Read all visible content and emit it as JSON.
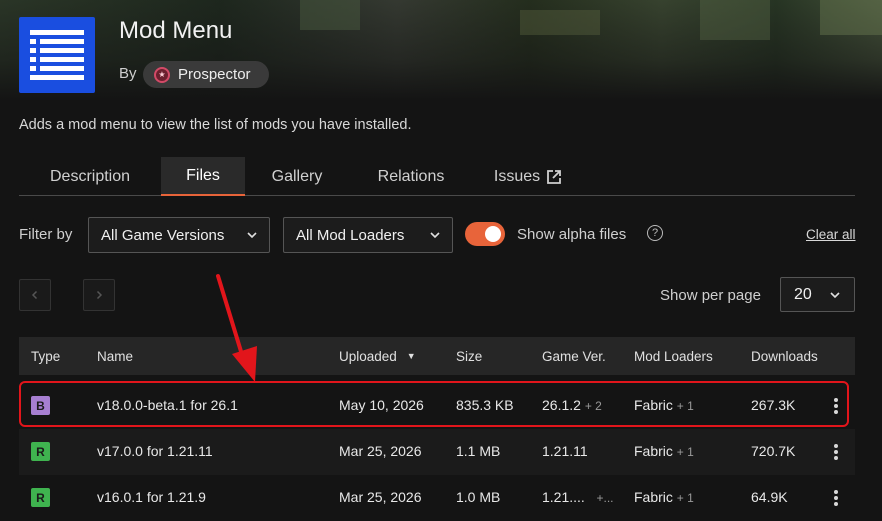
{
  "mod": {
    "title": "Mod Menu",
    "by_label": "By",
    "author": "Prospector",
    "summary": "Adds a mod menu to view the list of mods you have installed."
  },
  "tabs": [
    {
      "label": "Description",
      "active": false
    },
    {
      "label": "Files",
      "active": true
    },
    {
      "label": "Gallery",
      "active": false
    },
    {
      "label": "Relations",
      "active": false
    },
    {
      "label": "Issues",
      "active": false,
      "icon": "external-link-icon"
    }
  ],
  "filters": {
    "label": "Filter by",
    "game_versions": "All Game Versions",
    "mod_loaders": "All Mod Loaders",
    "show_alpha_label": "Show alpha files",
    "show_alpha_on": true,
    "clear_all": "Clear all"
  },
  "pagination": {
    "per_page_label": "Show per page",
    "per_page_value": "20"
  },
  "table": {
    "columns": [
      "Type",
      "Name",
      "Uploaded",
      "Size",
      "Game Ver.",
      "Mod Loaders",
      "Downloads"
    ],
    "sorted_by": "Uploaded",
    "rows": [
      {
        "type": "B",
        "type_color": "#a77fd1",
        "name": "v18.0.0-beta.1 for 26.1",
        "uploaded": "May 10, 2026",
        "size": "835.3 KB",
        "game_ver": "26.1.2",
        "game_ver_extra": "+ 2",
        "loader": "Fabric",
        "loader_extra": "+ 1",
        "downloads": "267.3K",
        "highlighted": true
      },
      {
        "type": "R",
        "type_color": "#3fb34f",
        "name": "v17.0.0 for 1.21.11",
        "uploaded": "Mar 25, 2026",
        "size": "1.1 MB",
        "game_ver": "1.21.11",
        "game_ver_extra": "",
        "loader": "Fabric",
        "loader_extra": "+ 1",
        "downloads": "720.7K",
        "highlighted": false
      },
      {
        "type": "R",
        "type_color": "#3fb34f",
        "name": "v16.0.1 for 1.21.9",
        "uploaded": "Mar 25, 2026",
        "size": "1.0 MB",
        "game_ver": "1.21....",
        "game_ver_extra": "+...",
        "loader": "Fabric",
        "loader_extra": "+ 1",
        "downloads": "64.9K",
        "highlighted": false
      }
    ]
  },
  "colors": {
    "accent": "#e8643a",
    "logo": "#1a4ee0",
    "highlight": "#e2151b",
    "beta": "#a77fd1",
    "release": "#3fb34f"
  }
}
